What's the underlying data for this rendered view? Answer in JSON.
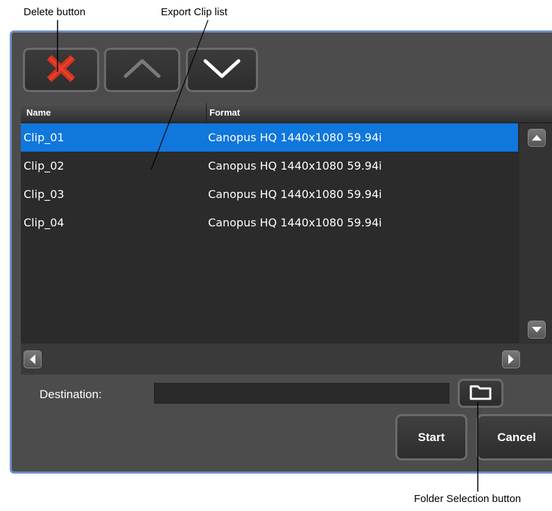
{
  "callouts": {
    "delete": "Delete button",
    "export_list": "Export Clip list",
    "folder": "Folder Selection button"
  },
  "toolbar": {
    "delete_icon": "x-icon",
    "up_icon": "chevron-up-icon",
    "down_icon": "chevron-down-icon"
  },
  "grid": {
    "columns": [
      "Name",
      "Format"
    ],
    "rows": [
      {
        "name": "Clip_01",
        "format": "Canopus HQ 1440x1080 59.94i",
        "selected": true
      },
      {
        "name": "Clip_02",
        "format": "Canopus HQ 1440x1080 59.94i",
        "selected": false
      },
      {
        "name": "Clip_03",
        "format": "Canopus HQ 1440x1080 59.94i",
        "selected": false
      },
      {
        "name": "Clip_04",
        "format": "Canopus HQ 1440x1080 59.94i",
        "selected": false
      }
    ]
  },
  "destination": {
    "label": "Destination:",
    "value": ""
  },
  "buttons": {
    "start": "Start",
    "cancel": "Cancel"
  },
  "colors": {
    "selection": "#1077dc",
    "window_border": "#6f8fc8",
    "delete_red": "#d9301e"
  }
}
